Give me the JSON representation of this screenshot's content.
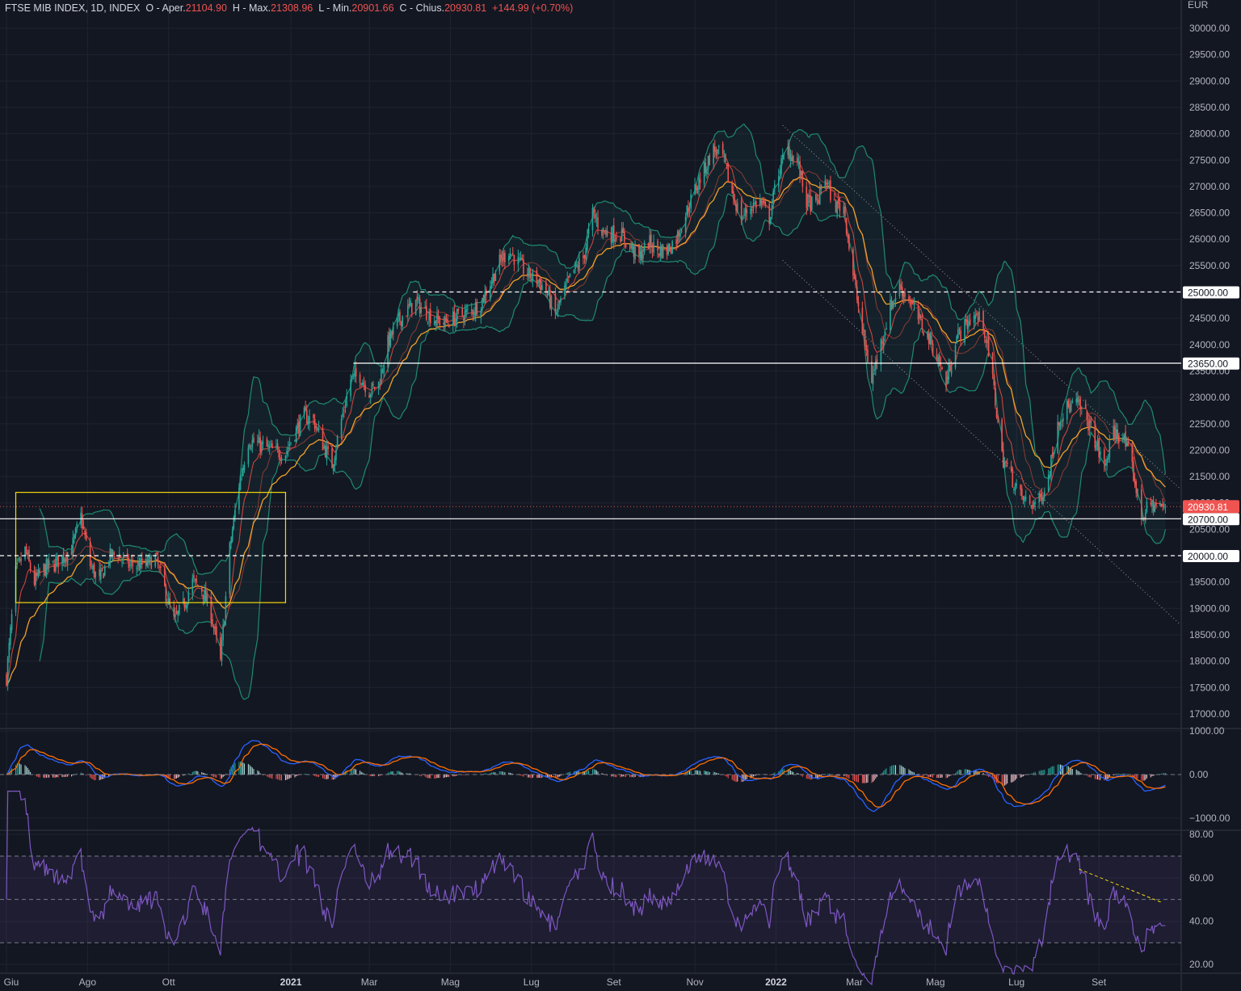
{
  "header": {
    "symbol": "FTSE MIB INDEX, 1D, INDEX",
    "open_label": "O - Aper.",
    "open": "21104.90",
    "high_label": "H - Max.",
    "high": "21308.96",
    "low_label": "L - Min.",
    "low": "20901.66",
    "close_label": "C - Chius.",
    "close": "20930.81",
    "change": "+144.99 (+0.70%)"
  },
  "colors": {
    "background": "#131722",
    "grid": "#1f2330",
    "up": "#26a69a",
    "down": "#ef5350",
    "bollinger": "#1f8a70",
    "sma": "#c8453f",
    "ma_slow": "#f0a02a",
    "macd": "#2962ff",
    "signal": "#ff6d00",
    "rsi": "#7e57c2",
    "rect": "#f5d90a",
    "last_price": "#f05350"
  },
  "price_axis": {
    "currency": "EUR",
    "ticks": [
      "30000.00",
      "29500.00",
      "29000.00",
      "28500.00",
      "28000.00",
      "27500.00",
      "27000.00",
      "26500.00",
      "26000.00",
      "25500.00",
      "25000.00",
      "24500.00",
      "24000.00",
      "23500.00",
      "23000.00",
      "22500.00",
      "22000.00",
      "21500.00",
      "21000.00",
      "20500.00",
      "20000.00",
      "19500.00",
      "19000.00",
      "18500.00",
      "18000.00",
      "17500.00",
      "17000.00"
    ],
    "last_price_label": "20930.81"
  },
  "macd_axis": {
    "ticks": [
      "1000.00",
      "0.00",
      "−1000.00"
    ]
  },
  "rsi_axis": {
    "ticks": [
      "80.00",
      "60.00",
      "40.00",
      "20.00"
    ]
  },
  "time_axis": {
    "labels": [
      {
        "text": "Giu",
        "date": "2020-06-01",
        "bold": false
      },
      {
        "text": "Ago",
        "date": "2020-08-01",
        "bold": false
      },
      {
        "text": "Ott",
        "date": "2020-10-01",
        "bold": false
      },
      {
        "text": "2021",
        "date": "2021-01-01",
        "bold": true
      },
      {
        "text": "Mar",
        "date": "2021-03-01",
        "bold": false
      },
      {
        "text": "Mag",
        "date": "2021-05-01",
        "bold": false
      },
      {
        "text": "Lug",
        "date": "2021-07-01",
        "bold": false
      },
      {
        "text": "Set",
        "date": "2021-09-01",
        "bold": false
      },
      {
        "text": "Nov",
        "date": "2021-11-01",
        "bold": false
      },
      {
        "text": "2022",
        "date": "2022-01-01",
        "bold": true
      },
      {
        "text": "Mar",
        "date": "2022-03-01",
        "bold": false
      },
      {
        "text": "Mag",
        "date": "2022-05-01",
        "bold": false
      },
      {
        "text": "Lug",
        "date": "2022-07-01",
        "bold": false
      },
      {
        "text": "Set",
        "date": "2022-09-01",
        "bold": false
      }
    ]
  },
  "drawings": {
    "levels": [
      {
        "label": "25000.00",
        "price": 25000,
        "from": "2021-04-03",
        "style": "dashed"
      },
      {
        "label": "23650.00",
        "price": 23650,
        "from": "2021-02-17",
        "style": "solid"
      },
      {
        "label": "20700.00",
        "price": 20700,
        "from": "2020-05-27",
        "style": "solid"
      },
      {
        "label": "20000.00",
        "price": 20000,
        "from": "2020-05-27",
        "style": "dashed"
      }
    ],
    "rectangle": {
      "from": "2020-06-08",
      "to": "2020-12-28",
      "top": 21200,
      "bottom": 19110
    },
    "channel": [
      {
        "from": [
          "2022-01-06",
          28160
        ],
        "to": [
          "2022-11-01",
          21270
        ]
      },
      {
        "from": [
          "2022-01-06",
          25600
        ],
        "to": [
          "2022-11-01",
          18700
        ]
      }
    ],
    "rsi_trendline": {
      "from": [
        "2022-08-17",
        64
      ],
      "to": [
        "2022-10-19",
        48.4
      ]
    }
  },
  "chart_data": {
    "type": "candlestick",
    "x_range": [
      "2020-06-01",
      "2022-10-17"
    ],
    "ylim": [
      16700,
      30300
    ],
    "closes": [
      17700,
      19670,
      20100,
      19500,
      19750,
      19820,
      19970,
      20130,
      20740,
      19820,
      19510,
      19970,
      20050,
      19820,
      19820,
      19820,
      19970,
      19360,
      18750,
      19050,
      19510,
      19360,
      18900,
      17980,
      20130,
      21350,
      22190,
      22120,
      22040,
      21960,
      21960,
      22340,
      22650,
      22570,
      22120,
      21730,
      22570,
      23340,
      23420,
      23110,
      23260,
      24030,
      24410,
      24640,
      24800,
      24640,
      24490,
      24410,
      24490,
      24570,
      24640,
      24800,
      25180,
      25560,
      25790,
      25560,
      25330,
      25250,
      25020,
      24570,
      25020,
      25410,
      25640,
      26480,
      26170,
      26100,
      26100,
      25870,
      25640,
      25940,
      25790,
      25790,
      26020,
      26480,
      26940,
      27320,
      27700,
      27550,
      26860,
      26400,
      26630,
      26710,
      26400,
      27320,
      27700,
      27470,
      26710,
      26630,
      27170,
      26630,
      26630,
      25330,
      24260,
      23340,
      24030,
      24720,
      25100,
      24870,
      24490,
      24180,
      23800,
      23260,
      24110,
      24340,
      24570,
      24410,
      23340,
      21890,
      21500,
      21120,
      20970,
      21040,
      21500,
      22570,
      22800,
      22880,
      22650,
      22190,
      21660,
      22340,
      22270,
      21660,
      20740,
      20970,
      20930.81
    ],
    "grid": true
  }
}
